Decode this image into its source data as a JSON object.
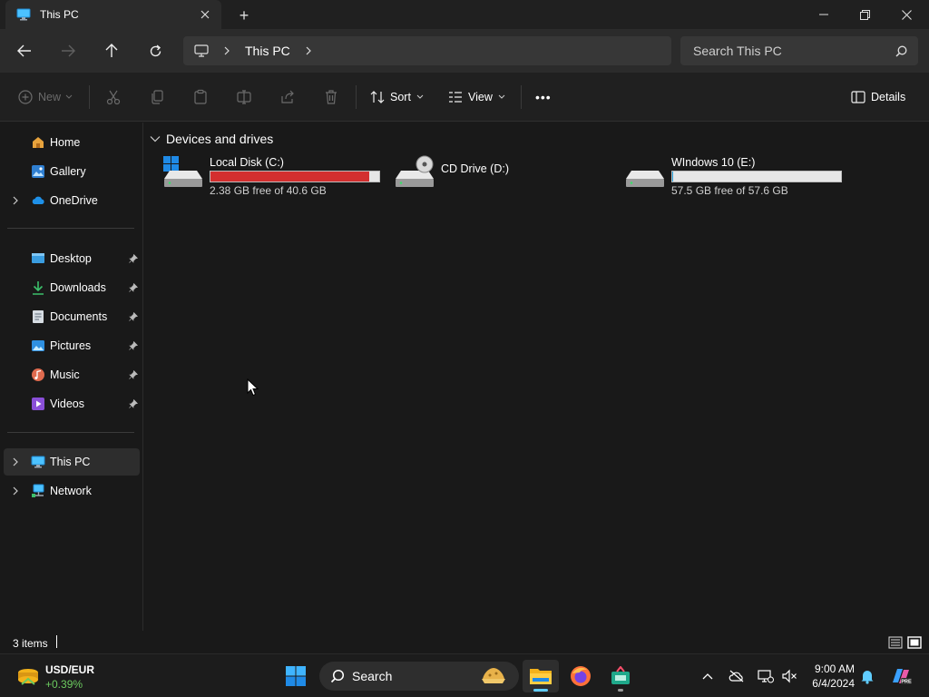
{
  "window": {
    "tab_title": "This PC",
    "tab_icon": "monitor-icon",
    "new_tab_label": "+",
    "controls": [
      "minimize-icon",
      "restore-icon",
      "close-icon"
    ]
  },
  "address": {
    "breadcrumb": [
      "This PC"
    ],
    "search_placeholder": "Search This PC"
  },
  "commands": {
    "new_label": "New",
    "sort_label": "Sort",
    "view_label": "View",
    "more_label": "•••",
    "details_label": "Details"
  },
  "sidebar": {
    "items": [
      {
        "label": "Home",
        "icon": "home-icon"
      },
      {
        "label": "Gallery",
        "icon": "gallery-icon"
      },
      {
        "label": "OneDrive",
        "icon": "cloud-icon"
      },
      {
        "label": "Desktop",
        "icon": "desktop-icon",
        "pinned": true
      },
      {
        "label": "Downloads",
        "icon": "download-icon",
        "pinned": true
      },
      {
        "label": "Documents",
        "icon": "document-icon",
        "pinned": true
      },
      {
        "label": "Pictures",
        "icon": "picture-icon",
        "pinned": true
      },
      {
        "label": "Music",
        "icon": "music-icon",
        "pinned": true
      },
      {
        "label": "Videos",
        "icon": "video-icon",
        "pinned": true
      },
      {
        "label": "This PC",
        "icon": "monitor-icon",
        "selected": true
      },
      {
        "label": "Network",
        "icon": "network-icon"
      }
    ]
  },
  "content": {
    "group_title": "Devices and drives",
    "drives": [
      {
        "name": "Local Disk (C:)",
        "free": "2.38 GB free of 40.6 GB",
        "used_fraction": 0.94,
        "bar_color": "#d32f2f"
      },
      {
        "name": "CD Drive (D:)",
        "free": "",
        "used_fraction": null,
        "bar_color": ""
      },
      {
        "name": "WIndows 10 (E:)",
        "free": "57.5 GB free of 57.6 GB",
        "used_fraction": 0.002,
        "bar_color": "#26a0da"
      }
    ]
  },
  "status": {
    "items_count": "3 items"
  },
  "taskbar": {
    "ticker_symbol": "USD/EUR",
    "ticker_change": "+0.39%",
    "search_label": "Search",
    "time": "9:00 AM",
    "date": "6/4/2024",
    "accent_color": "#60cdff"
  }
}
